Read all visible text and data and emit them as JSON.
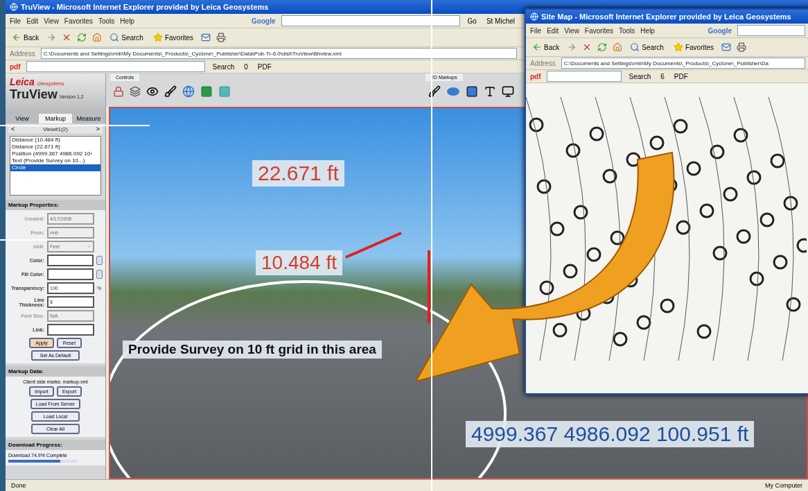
{
  "browser": {
    "title": "TruView - Microsoft Internet Explorer provided by Leica Geosystems",
    "menu": [
      "File",
      "Edit",
      "View",
      "Favorites",
      "Tools",
      "Help"
    ],
    "google": {
      "label": "Google",
      "go": "Go",
      "user": "St Michel"
    },
    "toolbar": [
      "Back",
      "Search",
      "Favorites"
    ],
    "address": {
      "label": "Address",
      "value": "C:\\Documents and Settings\\rmb\\My Documents\\_Products\\_Cyclone\\_Publisher\\Data\\Pub-Tr-6.0\\dist\\TruView\\Bhview.xml"
    },
    "pdf_bar": {
      "label": "pdf",
      "search": "Search",
      "count": "0",
      "pdf": "PDF"
    }
  },
  "app": {
    "logo": {
      "brand": "Leica",
      "sub": "Geosystems",
      "product": "TruView",
      "version": "Version 1.2"
    },
    "tabs": [
      {
        "label": "View",
        "selected": false
      },
      {
        "label": "Markup",
        "selected": true
      },
      {
        "label": "Measure",
        "selected": false
      }
    ],
    "view_nav": {
      "prev": "<",
      "label": "View#1(2)",
      "next": ">"
    },
    "markups": [
      {
        "label": "Distance (10.484 ft)",
        "selected": false
      },
      {
        "label": "Distance (22.671 ft)",
        "selected": false
      },
      {
        "label": "Position (4999.367 4986.092 10‹",
        "selected": false
      },
      {
        "label": "Text (Provide Survey on 10...)",
        "selected": false
      },
      {
        "label": "Circle",
        "selected": true
      }
    ],
    "properties": {
      "title": "Markup Properties:",
      "fields": [
        {
          "kind": "text",
          "label": "Created:",
          "value": "4/17/2008",
          "disabled": true
        },
        {
          "kind": "text",
          "label": "From:",
          "value": "rmb",
          "disabled": true
        },
        {
          "kind": "select",
          "label": "Unit:",
          "value": "Feet",
          "disabled": true
        },
        {
          "kind": "color",
          "label": "Color:",
          "disabled": false
        },
        {
          "kind": "color",
          "label": "Fill Color:",
          "disabled": false
        },
        {
          "kind": "percent",
          "label": "Transparency:",
          "value": "100",
          "unit": "%",
          "disabled": false
        },
        {
          "kind": "text",
          "label": "Line Thickness:",
          "value": "8",
          "disabled": false
        },
        {
          "kind": "text",
          "label": "Font Size:",
          "value": "N/A",
          "disabled": true
        },
        {
          "kind": "text",
          "label": "Link:",
          "disabled": false
        }
      ],
      "buttons": [
        {
          "label": "Apply",
          "highlighted": true
        },
        {
          "label": "Reset",
          "highlighted": false
        }
      ],
      "default_button": "Set As Default"
    },
    "data": {
      "title": "Markup Data:",
      "note": "Client side marks: markup.xml",
      "buttons": [
        [
          "Import",
          "Export"
        ],
        [
          "Load From Server"
        ],
        [
          "Load Local"
        ],
        [
          "Clear All"
        ]
      ]
    },
    "download": {
      "title": "Download Progress:",
      "text": "Download 74.9% Complete",
      "level": 0.749
    },
    "controls_tab": "Controls",
    "markups_tab": "2D Markups"
  },
  "viewer": {
    "measure_top": "22.671 ft",
    "measure_mid": "10.484 ft",
    "note": "Provide Survey on 10 ft grid in this area",
    "position": "4999.367 4986.092 100.951 ft"
  },
  "site_map_window": {
    "title": "Site Map - Microsoft Internet Explorer provided by Leica Geosystems",
    "menu": [
      "File",
      "Edit",
      "View",
      "Favorites",
      "Tools",
      "Help"
    ],
    "google": "Google",
    "toolbar": [
      "Back",
      "Search",
      "Favorites"
    ],
    "address": {
      "label": "Address",
      "value": "C:\\Documents and Settings\\rmb\\My Documents\\_Products\\_Cyclone\\_Publisher\\Da"
    },
    "pdf_bar": {
      "label": "pdf",
      "search": "Search",
      "count": "6",
      "pdf": "PDF"
    }
  },
  "status_bar": {
    "left": "Done",
    "right": "My Computer"
  }
}
